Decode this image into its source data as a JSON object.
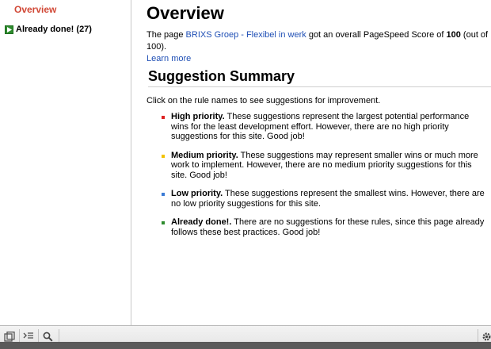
{
  "sidebar": {
    "overview_label": "Overview",
    "already_done_label": "Already done! (27)"
  },
  "main": {
    "title": "Overview",
    "intro": {
      "prefix": "The page ",
      "page_link": "BRIXS Groep - Flexibel in werk",
      "middle": " got an overall PageSpeed Score of ",
      "score": "100",
      "suffix": " (out of 100).",
      "learn_more": "Learn more"
    },
    "summary_title": "Suggestion Summary",
    "click_text": "Click on the rule names to see suggestions for improvement.",
    "rules": [
      {
        "color": "#dd2222",
        "label": "High priority.",
        "text": " These suggestions represent the largest potential performance wins for the least development effort. However, there are no high priority suggestions for this site. Good job!"
      },
      {
        "color": "#f2c200",
        "label": "Medium priority.",
        "text": " These suggestions may represent smaller wins or much more work to implement. However, there are no medium priority suggestions for this site. Good job!"
      },
      {
        "color": "#3a7bd5",
        "label": "Low priority.",
        "text": " These suggestions represent the smallest wins. However, there are no low priority suggestions for this site."
      },
      {
        "color": "#2e8b2e",
        "label": "Already done!.",
        "text": " There are no suggestions for these rules, since this page already follows these best practices. Good job!"
      }
    ]
  },
  "toolbar": {
    "icons": [
      "dock-icon",
      "console-icon",
      "search-icon",
      "gear-icon"
    ]
  },
  "colors": {
    "accent": "#d14836",
    "link": "#1f4fb5"
  }
}
